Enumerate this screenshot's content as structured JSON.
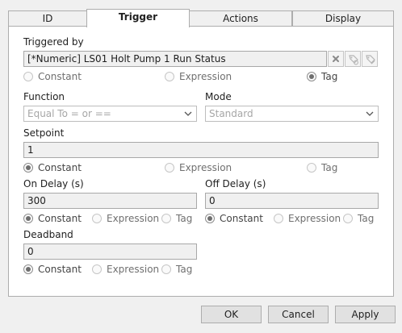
{
  "tabs": [
    {
      "label": "ID"
    },
    {
      "label": "Trigger"
    },
    {
      "label": "Actions"
    },
    {
      "label": "Display"
    }
  ],
  "triggered_by": {
    "label": "Triggered by",
    "value": "[*Numeric]    LS01 Holt Pump 1 Run Status",
    "options": [
      "Constant",
      "Expression",
      "Tag"
    ],
    "selected": "Tag"
  },
  "function": {
    "label": "Function",
    "placeholder": "Equal To = or =="
  },
  "mode": {
    "label": "Mode",
    "placeholder": "Standard"
  },
  "setpoint": {
    "label": "Setpoint",
    "value": "1",
    "options": [
      "Constant",
      "Expression",
      "Tag"
    ],
    "selected": "Constant"
  },
  "on_delay": {
    "label": "On Delay (s)",
    "value": "300",
    "options": [
      "Constant",
      "Expression",
      "Tag"
    ],
    "selected": "Constant"
  },
  "off_delay": {
    "label": "Off Delay (s)",
    "value": "0",
    "options": [
      "Constant",
      "Expression",
      "Tag"
    ],
    "selected": "Constant"
  },
  "deadband": {
    "label": "Deadband",
    "value": "0",
    "options": [
      "Constant",
      "Expression",
      "Tag"
    ],
    "selected": "Constant"
  },
  "icons": {
    "clear": "clear-x-icon",
    "browse": "tag-browse-icon",
    "edit": "tag-edit-icon",
    "chevron": "chevron-down-icon"
  },
  "buttons": {
    "ok": "OK",
    "cancel": "Cancel",
    "apply": "Apply"
  }
}
